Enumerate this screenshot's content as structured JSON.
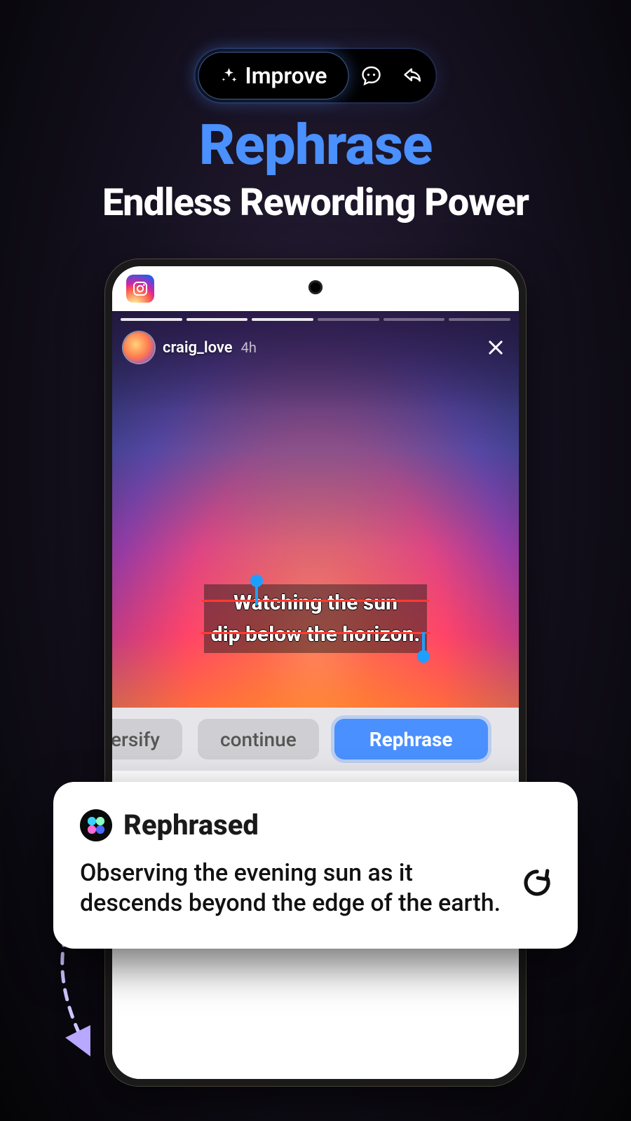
{
  "toolbar": {
    "improve_label": "Improve"
  },
  "headline": "Rephrase",
  "subheadline": "Endless Rewording Power",
  "story": {
    "username": "craig_love",
    "time": "4h",
    "selected_text": "Watching the sun\ndip below the horizon."
  },
  "actions": {
    "partial": "ersify",
    "continue": "continue",
    "rephrase": "Rephrase"
  },
  "result": {
    "title": "Rephrased",
    "body": "Observing the evening sun as it descends beyond the edge of the earth."
  }
}
